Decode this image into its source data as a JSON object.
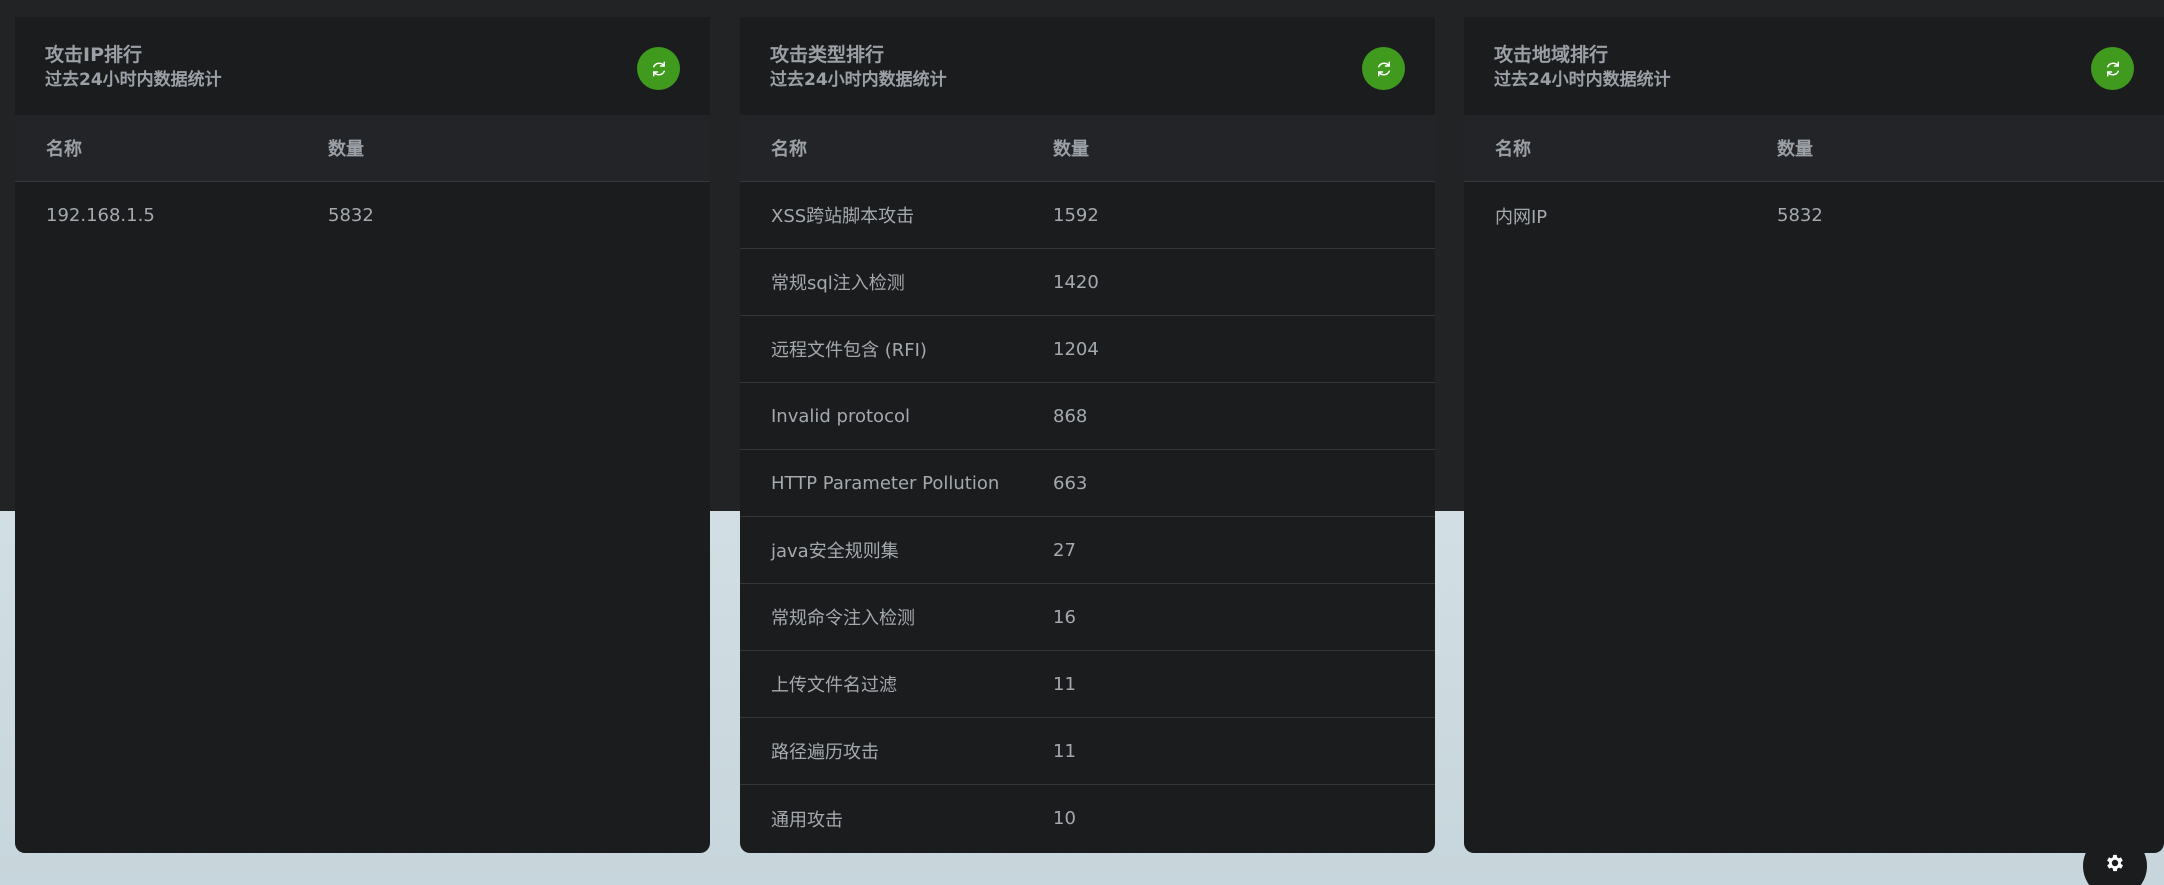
{
  "panels": [
    {
      "title": "攻击IP排行",
      "subtitle": "过去24小时内数据统计",
      "headers": {
        "name": "名称",
        "count": "数量"
      },
      "rows": [
        {
          "name": "192.168.1.5",
          "count": "5832"
        }
      ]
    },
    {
      "title": "攻击类型排行",
      "subtitle": "过去24小时内数据统计",
      "headers": {
        "name": "名称",
        "count": "数量"
      },
      "rows": [
        {
          "name": "XSS跨站脚本攻击",
          "count": "1592"
        },
        {
          "name": "常规sql注入检测",
          "count": "1420"
        },
        {
          "name": "远程文件包含 (RFI)",
          "count": "1204"
        },
        {
          "name": "Invalid protocol",
          "count": "868"
        },
        {
          "name": "HTTP Parameter Pollution",
          "count": "663"
        },
        {
          "name": "java安全规则集",
          "count": "27"
        },
        {
          "name": "常规命令注入检测",
          "count": "16"
        },
        {
          "name": "上传文件名过滤",
          "count": "11"
        },
        {
          "name": "路径遍历攻击",
          "count": "11"
        },
        {
          "name": "通用攻击",
          "count": "10"
        }
      ]
    },
    {
      "title": "攻击地域排行",
      "subtitle": "过去24小时内数据统计",
      "headers": {
        "name": "名称",
        "count": "数量"
      },
      "rows": [
        {
          "name": "内网IP",
          "count": "5832"
        }
      ]
    }
  ],
  "icons": {
    "refresh": "refresh-icon",
    "settings": "gear-icon"
  },
  "colors": {
    "accent": "#3f9a1e",
    "card": "#1b1c1e",
    "text": "#a4a9ae"
  }
}
